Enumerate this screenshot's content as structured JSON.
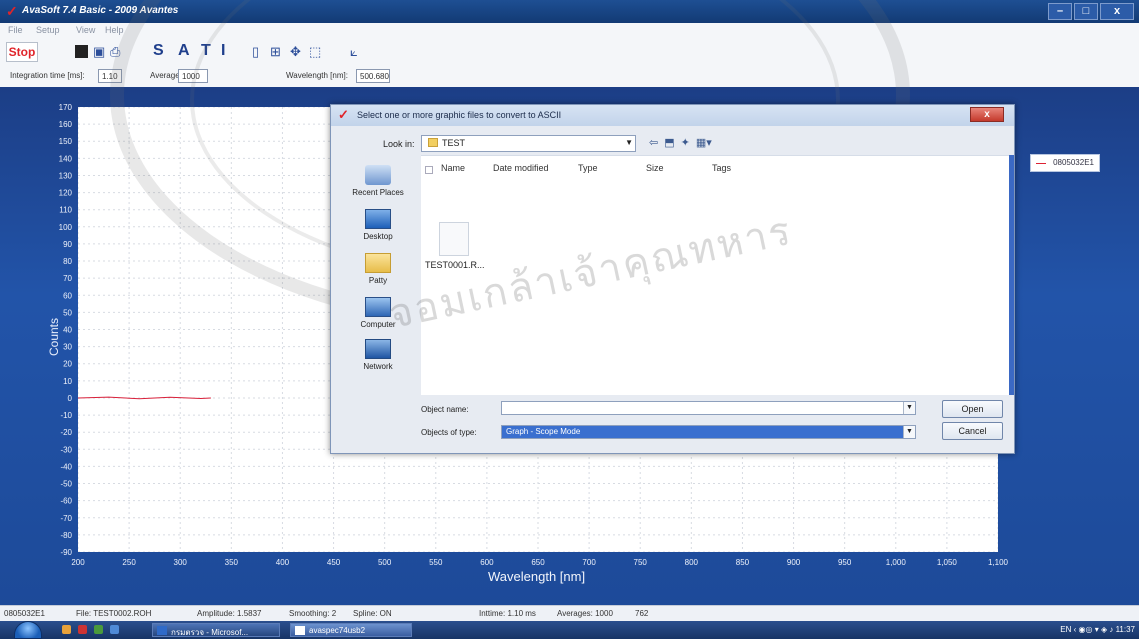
{
  "window": {
    "title": "AvaSoft 7.4 Basic - 2009 Avantes",
    "controls": [
      "–",
      "□",
      "x"
    ]
  },
  "menu": [
    "File",
    "Setup",
    "View",
    "Help"
  ],
  "toolbar": {
    "stop_label": "Stop",
    "mode_letters": [
      "S",
      "A",
      "T",
      "I"
    ]
  },
  "params": {
    "integration_label": "Integration time [ms]:",
    "integration_value": "1.10",
    "average_label": "Average:",
    "average_value": "1000",
    "wavelength_label": "Wavelength [nm]:",
    "wavelength_value": "500.680"
  },
  "chart_data": {
    "type": "line",
    "title": "",
    "xlabel": "Wavelength [nm]",
    "ylabel": "Counts",
    "xlim": [
      200,
      1100
    ],
    "ylim": [
      -90,
      170
    ],
    "x_ticks": [
      200,
      250,
      300,
      350,
      400,
      450,
      500,
      550,
      600,
      650,
      700,
      750,
      800,
      850,
      900,
      950,
      1000,
      1050,
      1100
    ],
    "x_tick_labels": [
      "200",
      "250",
      "300",
      "350",
      "400",
      "450",
      "500",
      "550",
      "600",
      "650",
      "700",
      "750",
      "800",
      "850",
      "900",
      "950",
      "1,000",
      "1,050",
      "1,100"
    ],
    "y_ticks": [
      170,
      160,
      150,
      140,
      130,
      120,
      110,
      100,
      90,
      80,
      70,
      60,
      50,
      40,
      30,
      20,
      10,
      0,
      -10,
      -20,
      -30,
      -40,
      -50,
      -60,
      -70,
      -80,
      -90
    ],
    "grid": true,
    "legend": "right",
    "series": [
      {
        "name": "0805032E1",
        "color": "#d8203a",
        "x": [
          200,
          230,
          260,
          290,
          320,
          330
        ],
        "y": [
          0,
          0.5,
          -0.5,
          0.4,
          -0.3,
          0
        ]
      }
    ]
  },
  "dialog": {
    "title": "Select one or more graphic files to convert to ASCII",
    "close": "x",
    "look_in_label": "Look in:",
    "look_in_value": "TEST",
    "places": [
      "Recent Places",
      "Desktop",
      "Patty",
      "Computer",
      "Network"
    ],
    "columns": [
      "Name",
      "Date modified",
      "Type",
      "Size",
      "Tags"
    ],
    "files": [
      "TEST0001.R..."
    ],
    "object_name_label": "Object name:",
    "object_name_value": "",
    "objects_type_label": "Objects of type:",
    "objects_type_value": "Graph - Scope Mode",
    "open_label": "Open",
    "cancel_label": "Cancel"
  },
  "status": {
    "device": "0805032E1",
    "file": "File: TEST0002.ROH",
    "amplitude": "Amplitude: 1.5837",
    "smoothing": "Smoothing: 2",
    "spline": "Spline: ON",
    "inttime": "Inttime: 1.10 ms",
    "averages": "Averages: 1000",
    "count": "762"
  },
  "taskbar": {
    "tasks": [
      "กรมตรวจ - Microsof...",
      "avaspec74usb2"
    ],
    "tray_lang": "EN",
    "clock": "11:37"
  }
}
